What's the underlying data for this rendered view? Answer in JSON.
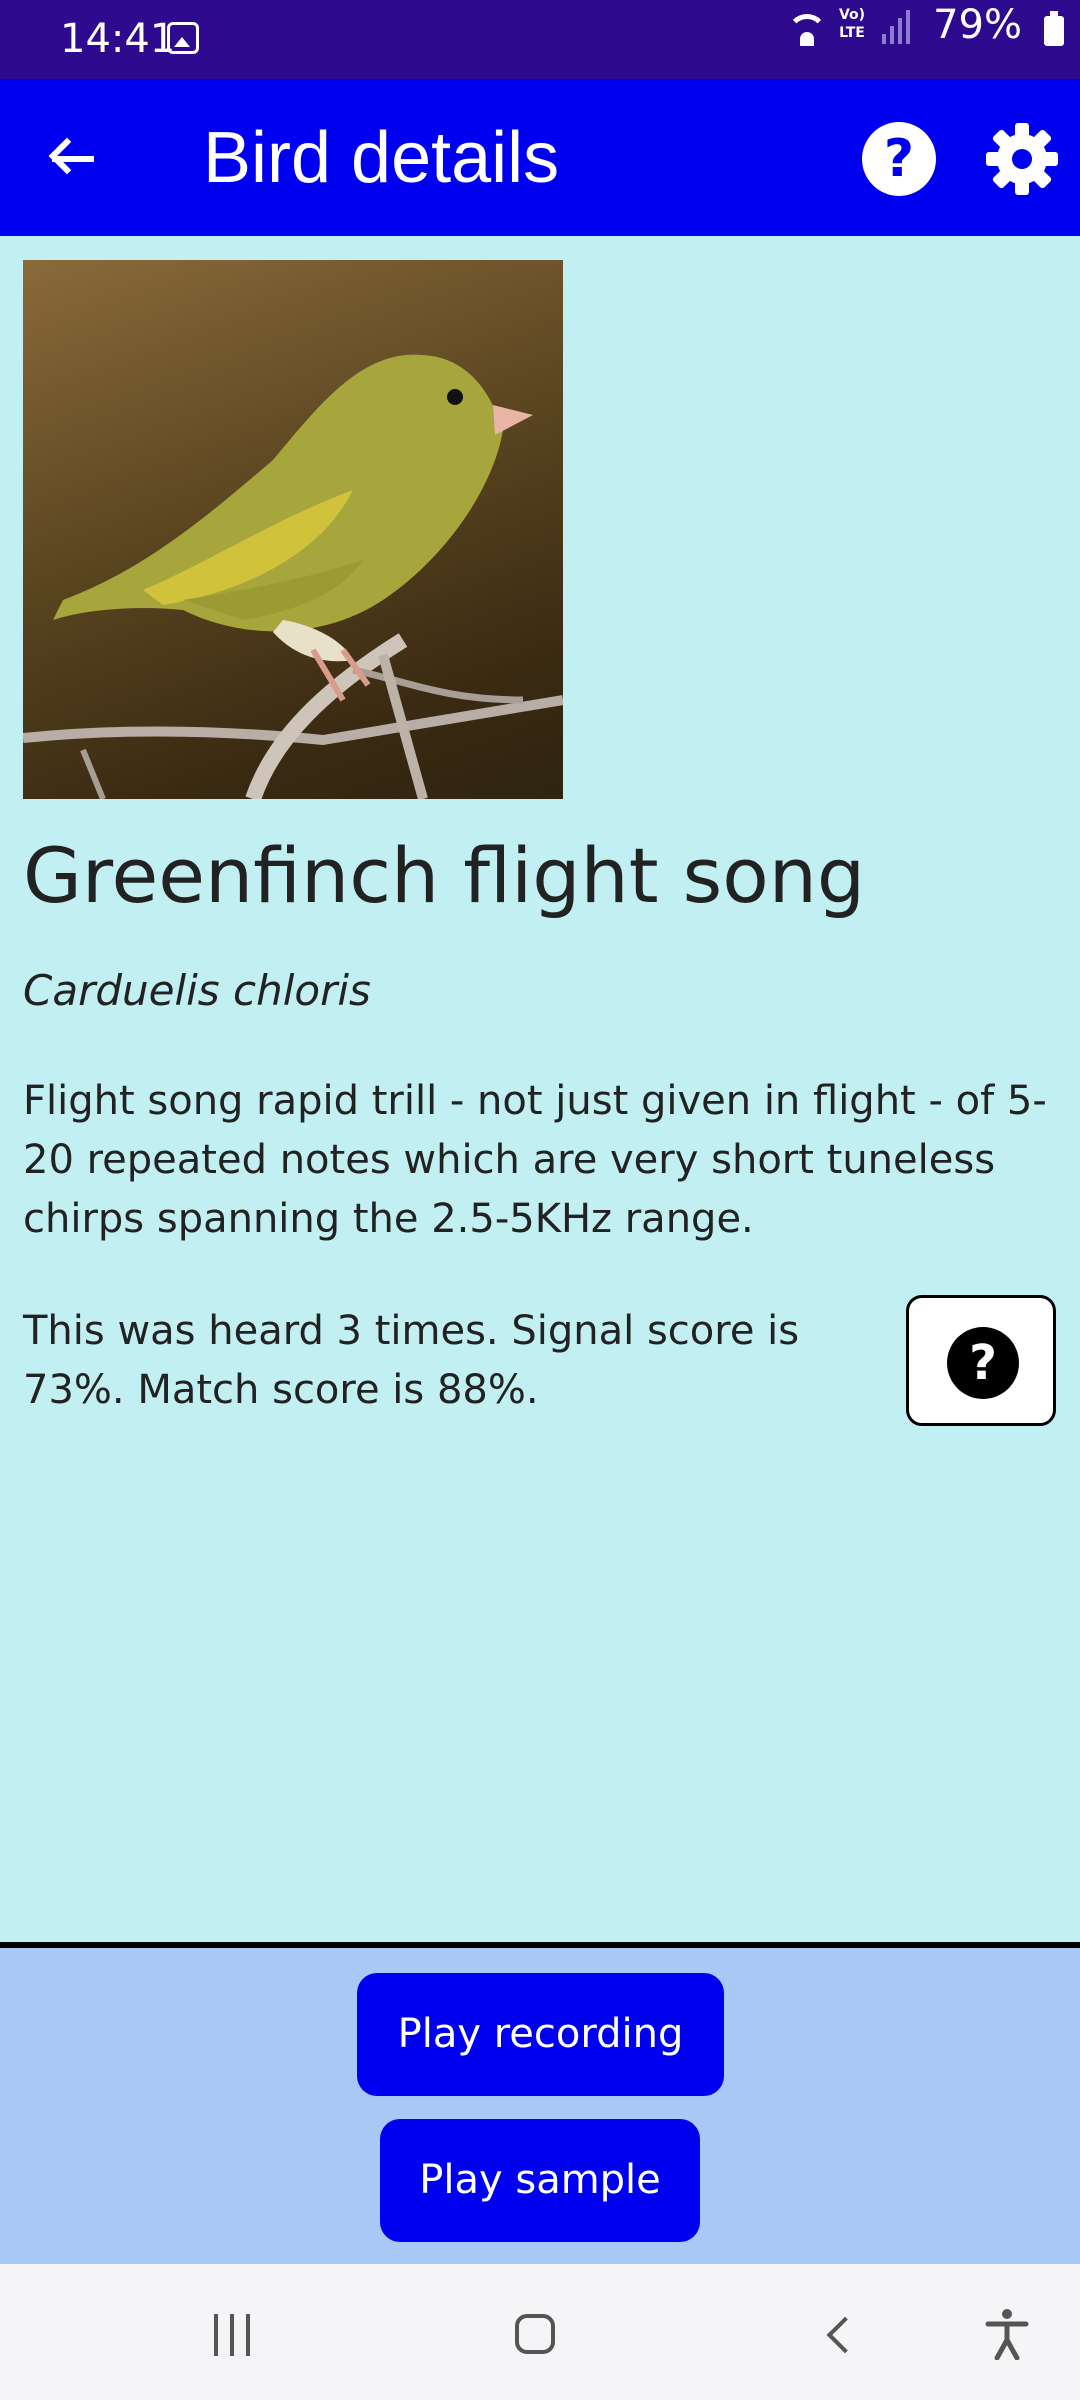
{
  "status_bar": {
    "time": "14:41",
    "network_label": "Vo) LTE",
    "battery": "79%",
    "icons": [
      "gallery-icon",
      "wifi-icon",
      "volte-icon",
      "signal-icon",
      "battery-icon"
    ]
  },
  "app_bar": {
    "title": "Bird details",
    "icons": [
      "back-arrow-icon",
      "help-icon",
      "settings-gear-icon"
    ],
    "help_symbol": "?"
  },
  "bird": {
    "common_name": "Greenfinch flight song",
    "latin_name": "Carduelis chloris",
    "description": "Flight song rapid trill - not just given in flight - of 5-20 repeated notes which are very short tuneless chirps spanning the 2.5-5KHz range.",
    "stats": "This was heard 3 times. Signal score is 73%. Match score is 88%.",
    "stats_help_symbol": "?"
  },
  "actions": {
    "play_recording": "Play recording",
    "play_sample": "Play sample"
  },
  "nav_bar": {
    "icons": [
      "recents-icon",
      "home-icon",
      "back-icon",
      "accessibility-icon"
    ]
  },
  "colors": {
    "status_bar": "#2e0a8e",
    "app_bar": "#0000f0",
    "content_background": "#c2f0f2",
    "bottom_panel": "#a8c8f5",
    "button": "#0000f0"
  }
}
